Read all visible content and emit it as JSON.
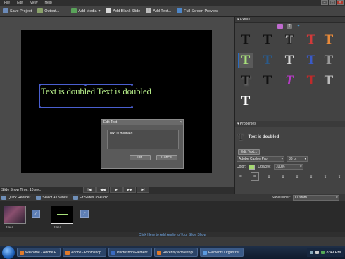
{
  "menu": [
    "File",
    "Edit",
    "View",
    "Help"
  ],
  "toolbar": {
    "save": "Save Project",
    "output": "Output...",
    "add_media": "Add Media",
    "add_blank": "Add Blank Slide",
    "add_text": "Add Text...",
    "full_screen": "Full Screen Preview"
  },
  "stage": {
    "text": "Text is doubled Text is doubled",
    "text_color": "#b8f08a"
  },
  "dialog": {
    "title": "Edit Text",
    "value": "Text is doubled",
    "ok": "OK",
    "cancel": "Cancel"
  },
  "status": {
    "time": "Slide Show Time: 10 sec."
  },
  "transport": [
    "|◀",
    "◀◀",
    "▶",
    "▶▶",
    "▶|"
  ],
  "extras": {
    "title": "Extras"
  },
  "properties": {
    "title": "Properties",
    "item_label": "Text is doubled",
    "edit_text": "Edit Text...",
    "font": "Adobe Caslon Pro",
    "size": "36 pt",
    "color_label": "Color:",
    "opacity_label": "Opacity:",
    "opacity": "100%"
  },
  "quick": {
    "reorder": "Quick Reorder",
    "select_all": "Select All Slides",
    "fit": "Fit Slides To Audio",
    "slide_order_label": "Slide Order:",
    "slide_order_value": "Custom"
  },
  "slides": [
    {
      "label": "2 sec"
    },
    {
      "label": "2 sec"
    }
  ],
  "audio_bar": "Click Here to Add Audio to Your Slide Show",
  "taskbar": {
    "items": [
      "Welcome - Adobe P...",
      "Adobe - Photoshop ...",
      "Photoshop Element...",
      "Recently active topi...",
      "Elements Organizer"
    ],
    "time": "8:49 PM"
  },
  "colors": {
    "accent": "#2b6cc0",
    "stage_text": "#b8f08a",
    "link": "#6ea3e0"
  }
}
